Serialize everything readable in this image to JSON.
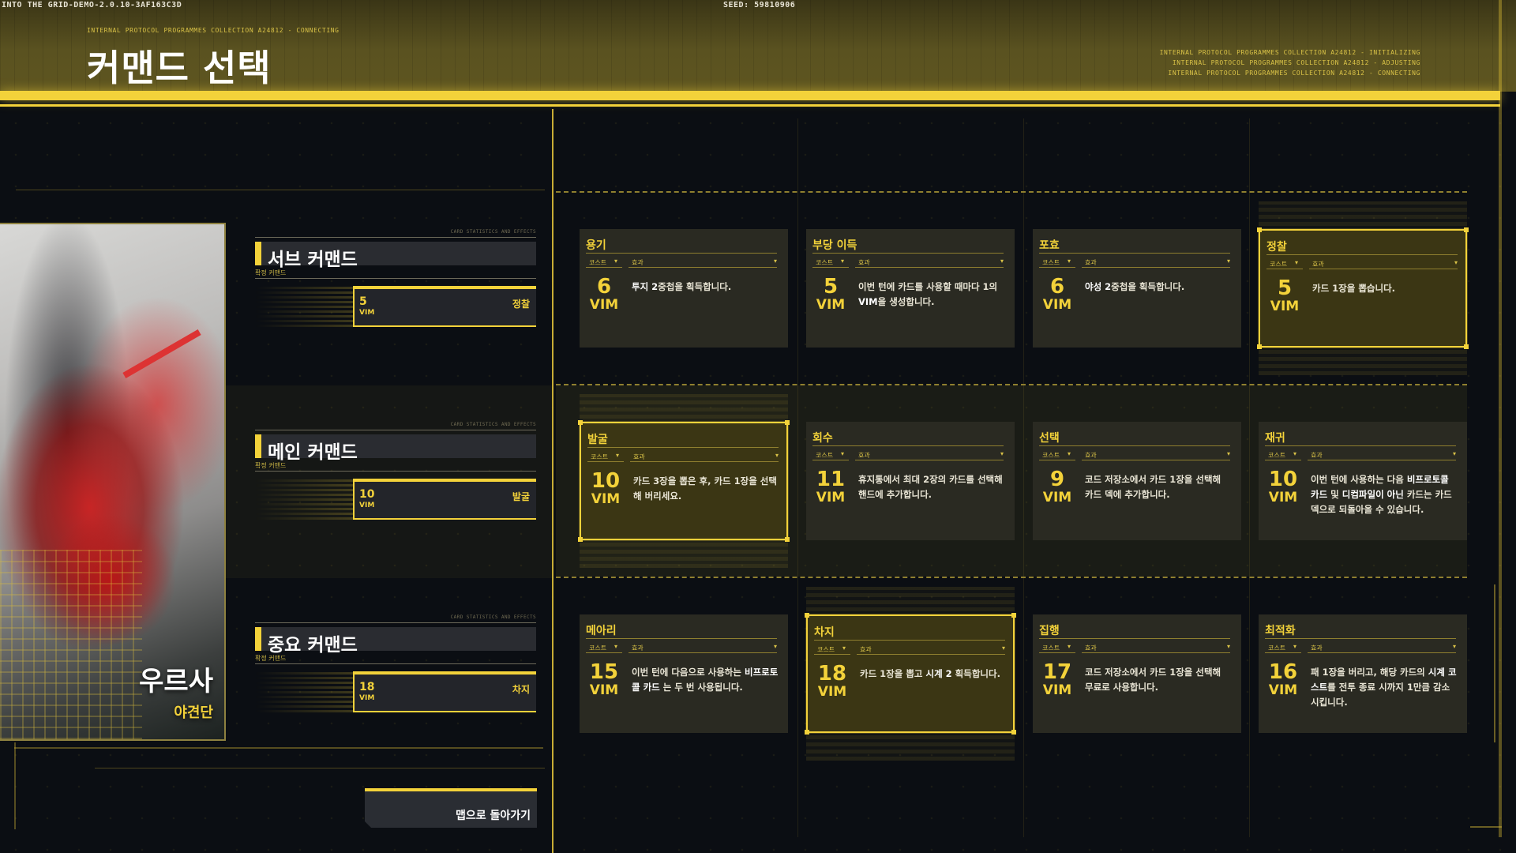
{
  "build_id": "INTO THE GRID-DEMO-2.0.10-3AF163C3D",
  "seed": "SEED: 59810906",
  "header": {
    "protocol_line": "INTERNAL PROTOCOL PROGRAMMES COLLECTION A24812 - CONNECTING",
    "title": "커맨드 선택",
    "status_lines": [
      "INTERNAL PROTOCOL PROGRAMMES COLLECTION A24812 - INITIALIZING",
      "INTERNAL PROTOCOL PROGRAMMES COLLECTION A24812 - ADJUSTING",
      "INTERNAL PROTOCOL PROGRAMMES COLLECTION A24812 - CONNECTING"
    ]
  },
  "character": {
    "name": "우르사",
    "class": "야견단"
  },
  "slots": [
    {
      "tiny": "CARD STATISTICS AND EFFECTS",
      "title": "서브 커맨드",
      "sub": "확정 커맨드",
      "cost": "5",
      "unit": "VIM",
      "chosen": "정찰"
    },
    {
      "tiny": "CARD STATISTICS AND EFFECTS",
      "title": "메인 커맨드",
      "sub": "확정 커맨드",
      "cost": "10",
      "unit": "VIM",
      "chosen": "발굴"
    },
    {
      "tiny": "CARD STATISTICS AND EFFECTS",
      "title": "중요 커맨드",
      "sub": "확정 커맨드",
      "cost": "18",
      "unit": "VIM",
      "chosen": "차지"
    }
  ],
  "card_labels": {
    "cost": "코스트",
    "effect": "효과",
    "unit": "VIM"
  },
  "cards": [
    {
      "title": "용기",
      "cost": "6",
      "desc_html": "<b>투지 2</b>중첩을 획득합니다.",
      "selected": false
    },
    {
      "title": "부당 이득",
      "cost": "5",
      "desc_html": "이번 턴에 카드를 사용할 때마다 1의 <b>VIM</b>을 생성합니다.",
      "selected": false
    },
    {
      "title": "포효",
      "cost": "6",
      "desc_html": "<b>야성 2</b>중첩을 획득합니다.",
      "selected": false
    },
    {
      "title": "정찰",
      "cost": "5",
      "desc_html": "카드 1장을 뽑습니다.",
      "selected": true
    },
    {
      "title": "발굴",
      "cost": "10",
      "desc_html": "카드 3장을 뽑은 후, 카드 1장을 선택해 버리세요.",
      "selected": true
    },
    {
      "title": "회수",
      "cost": "11",
      "desc_html": "휴지통에서 최대 2장의 카드를 선택해 핸드에 추가합니다.",
      "selected": false
    },
    {
      "title": "선택",
      "cost": "9",
      "desc_html": "코드 저장소에서 카드 1장을 선택해 카드 덱에 추가합니다.",
      "selected": false
    },
    {
      "title": "재귀",
      "cost": "10",
      "desc_html": "이번 턴에 사용하는 다음 <b>비프로토콜 카드</b> 및 <b>디컴파일이 아닌</b> 카드는 카드 덱으로 되돌아올 수 있습니다.",
      "selected": false
    },
    {
      "title": "메아리",
      "cost": "15",
      "desc_html": "이번 턴에 다음으로 사용하는 <b>비프로토콜 카드</b> 는 두 번 사용됩니다.",
      "selected": false
    },
    {
      "title": "차지",
      "cost": "18",
      "desc_html": "카드 1장을 뽑고 <b>시계 2</b> 획득합니다.",
      "selected": true
    },
    {
      "title": "집행",
      "cost": "17",
      "desc_html": "코드 저장소에서 카드 1장을 선택해 무료로 사용합니다.",
      "selected": false
    },
    {
      "title": "최적화",
      "cost": "16",
      "desc_html": "패 1장을 버리고, 해당 카드의 <b>시계 코스트</b>를 전투 종료 시까지 1만큼 감소시킵니다.",
      "selected": false
    }
  ],
  "back_button": "맵으로 돌아가기",
  "colors": {
    "accent": "#f3d23a",
    "panel": "#2a2a22",
    "background": "#0b0e13"
  }
}
